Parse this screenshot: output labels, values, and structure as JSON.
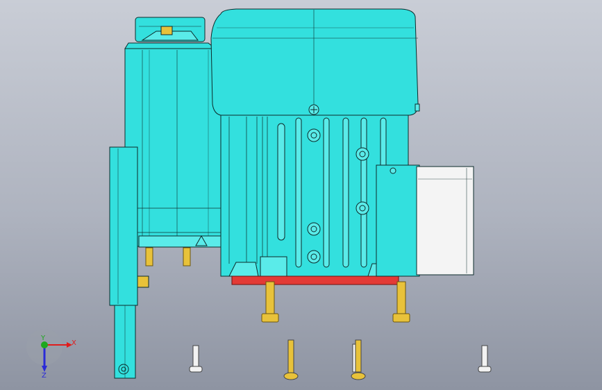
{
  "viewport": {
    "background_top": "#c9cdd6",
    "background_bottom": "#8e94a2"
  },
  "model": {
    "body_color": "#33e0de",
    "edge_color": "#0c2a2a",
    "fastener_color": "#e8c23a",
    "base_color": "#e33a36",
    "terminal_cover_color": "#f4f4f4",
    "screw_color": "#f2f2f2"
  },
  "triad": {
    "x_label": "X",
    "y_label": "Y",
    "z_label": "Z",
    "x_color": "#e01c1c",
    "y_color": "#1ea81e",
    "z_color": "#2a2ad8"
  }
}
